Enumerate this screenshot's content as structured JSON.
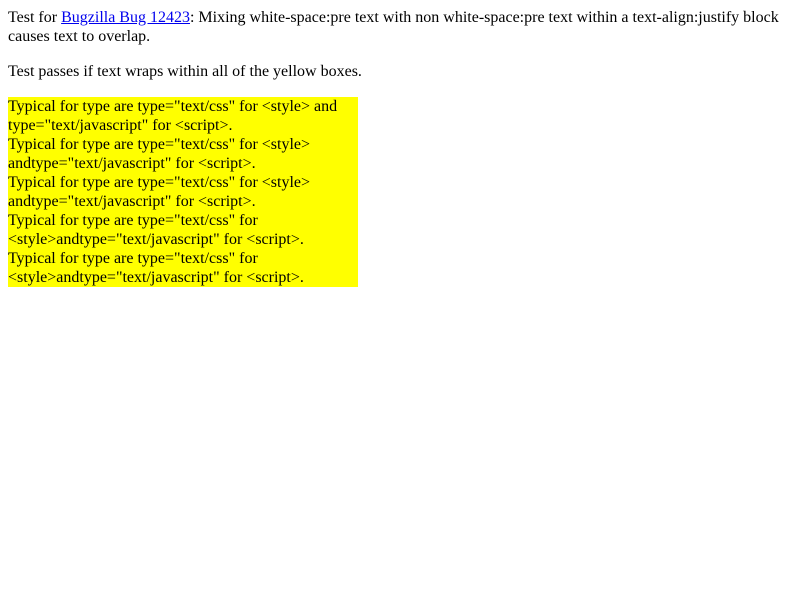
{
  "intro": {
    "prefix": "Test for ",
    "link_text": "Bugzilla Bug 12423",
    "suffix": ": Mixing white-space:pre text with non white-space:pre text within a text-align:justify block causes text to overlap."
  },
  "instruction": "Test passes if text wraps within all of the yellow boxes.",
  "boxes": [
    {
      "lines": [
        "Typical for type are type=\"text/css\" for <style> and",
        "type=\"text/javascript\" for <script>."
      ]
    },
    {
      "lines": [
        "Typical for type are type=\"text/css\" for <style>",
        "andtype=\"text/javascript\" for <script>."
      ]
    },
    {
      "lines": [
        "Typical for type are type=\"text/css\" for <style>",
        "andtype=\"text/javascript\" for <script>."
      ]
    },
    {
      "lines": [
        "Typical for type are type=\"text/css\" for",
        "<style>andtype=\"text/javascript\" for <script>."
      ]
    },
    {
      "lines": [
        "Typical for type are type=\"text/css\" for",
        "<style>andtype=\"text/javascript\" for <script>."
      ]
    }
  ],
  "colors": {
    "highlight": "#ffff00",
    "link": "#0000ee",
    "text": "#000000",
    "background": "#ffffff"
  }
}
